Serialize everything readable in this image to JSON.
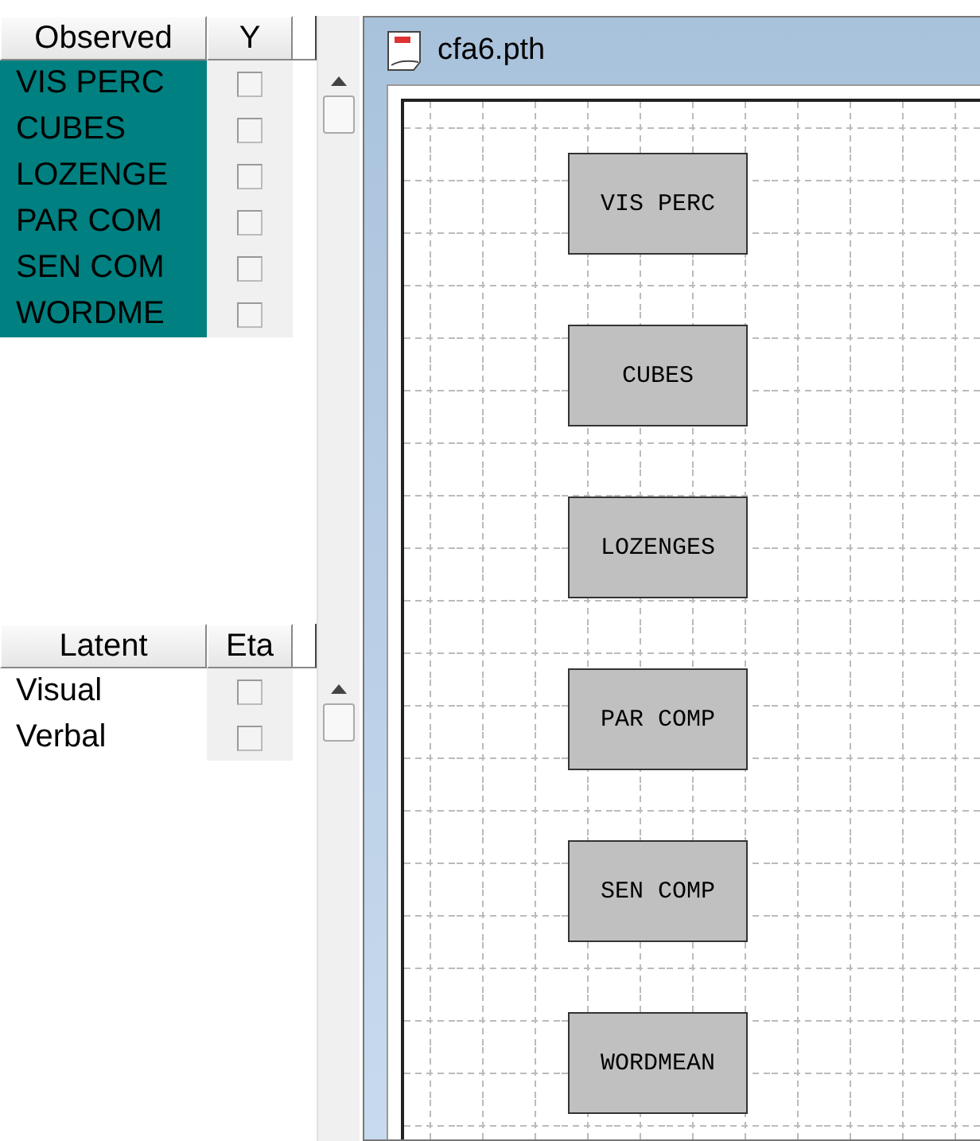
{
  "observed": {
    "columns": [
      "Observed",
      "Y"
    ],
    "rows": [
      {
        "name": "VIS PERC",
        "selected": true,
        "checked": false
      },
      {
        "name": "CUBES",
        "selected": true,
        "checked": false
      },
      {
        "name": "LOZENGE",
        "selected": true,
        "checked": false
      },
      {
        "name": "PAR COM",
        "selected": true,
        "checked": false
      },
      {
        "name": "SEN COM",
        "selected": true,
        "checked": false
      },
      {
        "name": "WORDME",
        "selected": true,
        "checked": false
      }
    ]
  },
  "latent": {
    "columns": [
      "Latent",
      "Eta"
    ],
    "rows": [
      {
        "name": "Visual",
        "selected": false,
        "checked": false
      },
      {
        "name": "Verbal",
        "selected": false,
        "checked": false
      }
    ]
  },
  "window": {
    "title": "cfa6.pth"
  },
  "diagram": {
    "nodes": [
      "VIS PERC",
      "CUBES",
      "LOZENGES",
      "PAR COMP",
      "SEN COMP",
      "WORDMEAN"
    ]
  }
}
